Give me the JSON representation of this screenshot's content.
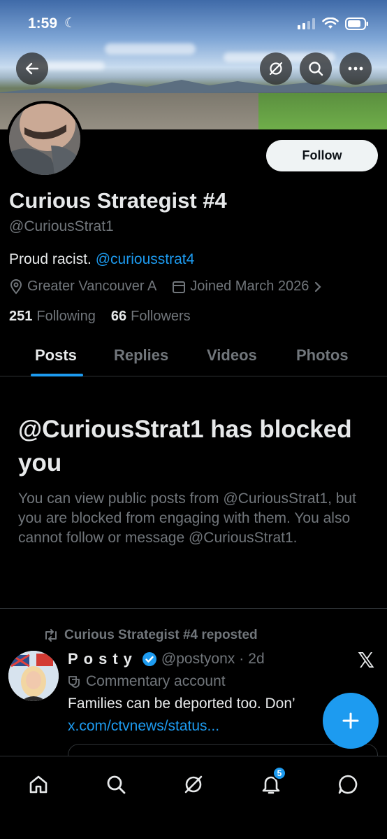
{
  "status_bar": {
    "time": "1:59"
  },
  "profile": {
    "display_name": "Curious Strategist #4",
    "handle": "@CuriousStrat1",
    "bio_text": "Proud racist.",
    "bio_mention": "@curiousstrat4",
    "location": "Greater Vancouver A",
    "joined": "Joined March 2026",
    "following_count": "251",
    "following_label": "Following",
    "followers_count": "66",
    "followers_label": "Followers",
    "follow_label": "Follow"
  },
  "tabs": [
    {
      "label": "Posts",
      "active": true
    },
    {
      "label": "Replies",
      "active": false
    },
    {
      "label": "Videos",
      "active": false
    },
    {
      "label": "Photos",
      "active": false
    }
  ],
  "blocked": {
    "title": "@CuriousStrat1 has blocked you",
    "message": "You can view public posts from @CuriousStrat1, but you are blocked from engaging with them. You also cannot follow or message @CuriousStrat1."
  },
  "post": {
    "repost_label": "Curious Strategist #4 reposted",
    "author_name": "Posty",
    "author_handle": "@postyonx",
    "time": "2d",
    "account_label": "Commentary account",
    "text": "Families can be deported too. Don’",
    "link": "x.com/ctvnews/status..."
  },
  "nav": {
    "notification_badge": "5"
  },
  "colors": {
    "accent": "#1d9bf0",
    "background": "#000000",
    "muted": "#71767b"
  }
}
